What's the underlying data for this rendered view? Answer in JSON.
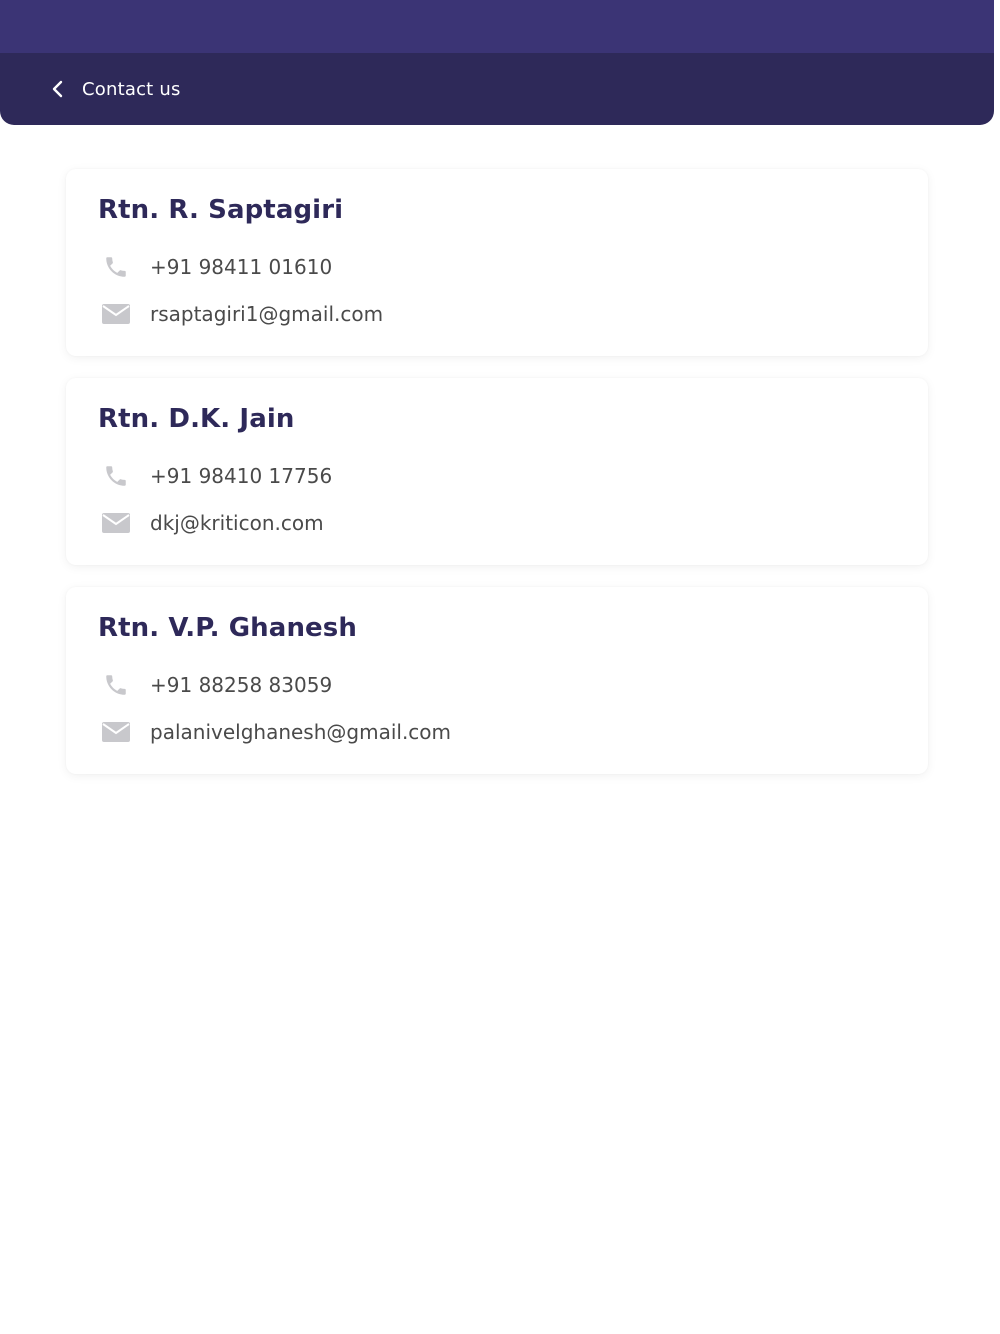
{
  "header": {
    "title": "Contact us"
  },
  "contacts": [
    {
      "name": "Rtn. R. Saptagiri",
      "phone": "+91 98411 01610",
      "email": "rsaptagiri1@gmail.com"
    },
    {
      "name": "Rtn. D.K. Jain",
      "phone": "+91 98410 17756",
      "email": "dkj@kriticon.com"
    },
    {
      "name": "Rtn. V.P. Ghanesh",
      "phone": "+91 88258 83059",
      "email": "palanivelghanesh@gmail.com"
    }
  ],
  "icons": {
    "back": "chevron-left-icon",
    "phone": "phone-icon",
    "email": "mail-icon"
  },
  "colors": {
    "status_bar": "#3b3475",
    "app_bar": "#2e2959",
    "name_text": "#2e2959",
    "detail_text": "#4a4a4a",
    "icon_gray": "#c8c8cc"
  }
}
